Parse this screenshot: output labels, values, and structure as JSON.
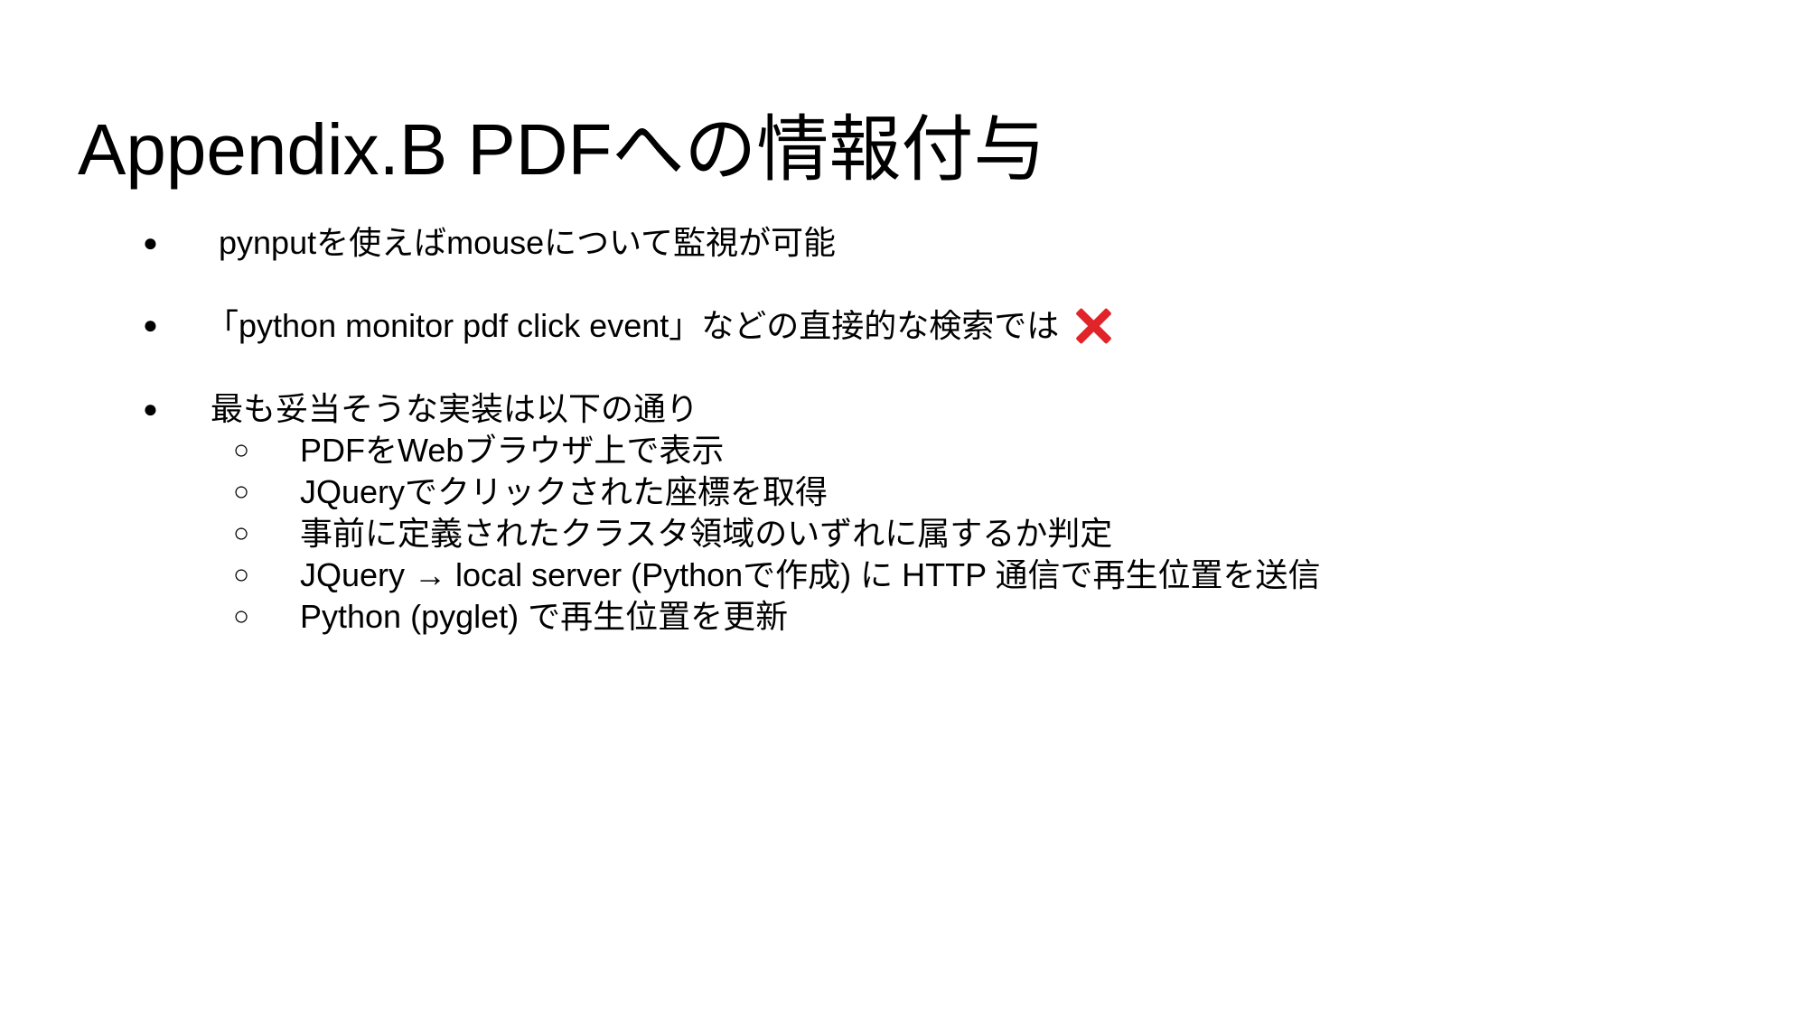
{
  "slide": {
    "title": "Appendix.B PDFへの情報付与",
    "bullet_symbol": "●",
    "sub_bullet_symbol": "○",
    "bullets": [
      {
        "text": "pynputを使えばmouseについて監視が可能"
      },
      {
        "text": "「python monitor pdf click event」などの直接的な検索では",
        "icon": "cross-mark-icon",
        "icon_color": "#e0242a"
      },
      {
        "text": "最も妥当そうな実装は以下の通り"
      }
    ],
    "sub_bullets": [
      "PDFをWebブラウザ上で表示",
      "JQueryでクリックされた座標を取得",
      "事前に定義されたクラスタ領域のいずれに属するか判定",
      "JQuery → local server (Pythonで作成) に HTTP 通信で再生位置を送信",
      "Python (pyglet) で再生位置を更新"
    ]
  }
}
